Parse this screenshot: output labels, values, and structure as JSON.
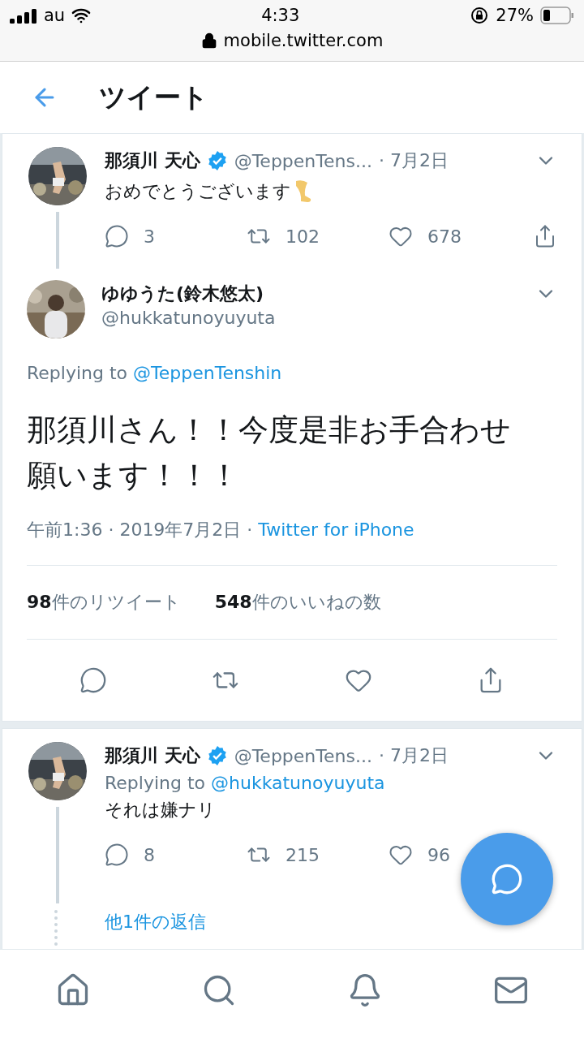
{
  "status_bar": {
    "carrier": "au",
    "time": "4:33",
    "battery": "27%",
    "url": "mobile.twitter.com"
  },
  "header": {
    "title": "ツイート"
  },
  "tweets": [
    {
      "kind": "thread",
      "name": "那須川 天心",
      "verified": true,
      "handle": "@TeppenTens...",
      "date": "· 7月2日",
      "text": "おめでとうございます",
      "stats": [
        "3",
        "102",
        "678"
      ]
    },
    {
      "kind": "focused",
      "name": "ゆゆうた(鈴木悠太)",
      "verified": false,
      "handle": "@hukkatunoyuyuta",
      "replying_prefix": "Replying to",
      "replying_to": "@TeppenTenshin",
      "text": "那須川さん！！今度是非お手合わせ願います！！！",
      "time": "午前1:36 · 2019年7月2日 ·",
      "source": "Twitter for iPhone",
      "retweets": "**98**件のリツイート",
      "likes": "**548**件のいいねの数"
    },
    {
      "kind": "thread",
      "name": "那須川 天心",
      "verified": true,
      "handle": "@TeppenTens...",
      "date": "· 7月2日",
      "replying_prefix": "Replying to",
      "replying_to": "@hukkatunoyuyuta",
      "text": "それは嫌ナリ",
      "stats": [
        "8",
        "215",
        "96"
      ],
      "more_replies": "他1件の返信"
    }
  ]
}
